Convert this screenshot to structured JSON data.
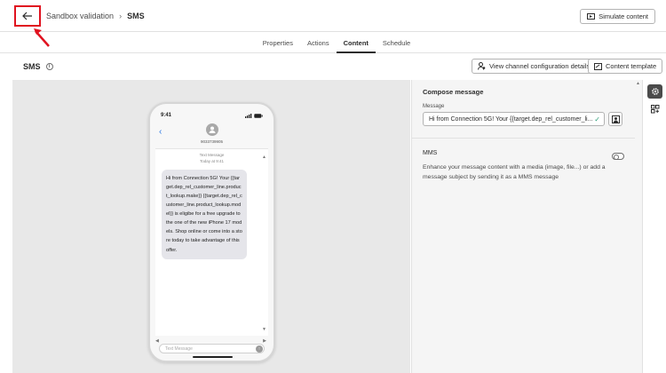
{
  "header": {
    "breadcrumb_parent": "Sandbox validation",
    "breadcrumb_separator": "›",
    "breadcrumb_current": "SMS",
    "simulate_label": "Simulate content"
  },
  "tabs": [
    {
      "label": "Properties",
      "active": false
    },
    {
      "label": "Actions",
      "active": false
    },
    {
      "label": "Content",
      "active": true
    },
    {
      "label": "Schedule",
      "active": false
    }
  ],
  "subheader": {
    "title": "SMS",
    "channel_config_label": "View channel configuration details",
    "content_template_label": "Content template"
  },
  "phone": {
    "time": "9:41",
    "contact_number": "9033739905",
    "meta_line1": "Text Message",
    "meta_line2": "Today at 9:41",
    "message": "Hi from Connection 5G! Your {{target.dep_rel_customer_line.product_lookup.make}} {{target.dep_rel_customer_line.product_lookup.model}} is eligibe for a free upgrade to the one of the new iPhone 17 models. Shop online or come into a store today to take advantage of this offer.",
    "compose_placeholder": "Text Message"
  },
  "panel": {
    "heading": "Compose message",
    "message_label": "Message",
    "message_value": "Hi from Connection 5G! Your {{target.dep_rel_customer_li...",
    "mms_label": "MMS",
    "mms_enabled": false,
    "mms_description": "Enhance your message content with a media (image, file...) or add a message subject by sending it as a MMS message"
  },
  "colors": {
    "annotation_red": "#e0121f",
    "preview_bg": "#e8e8e8",
    "bubble": "#e5e5ea",
    "check_green": "#2d9d78"
  }
}
